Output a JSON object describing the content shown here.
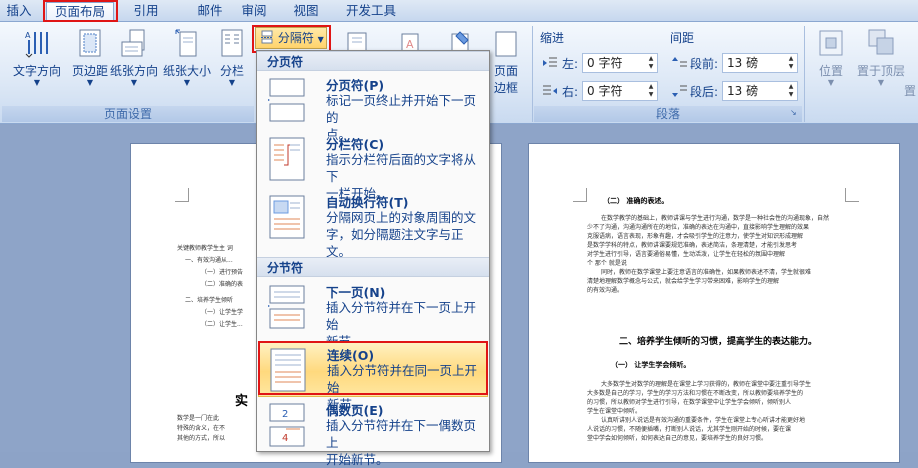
{
  "tabs": {
    "insert": "插入",
    "page_layout": "页面布局",
    "references": "引用",
    "mailings": "邮件",
    "review": "审阅",
    "view": "视图",
    "developer": "开发工具"
  },
  "ribbon": {
    "page_setup": {
      "label": "页面设置",
      "text_direction": "文字方向",
      "margins": "页边距",
      "orientation": "纸张方向",
      "size": "纸张大小",
      "columns": "分栏",
      "breaks": "分隔符"
    },
    "paragraph": {
      "label": "段落",
      "indent_label": "缩进",
      "spacing_label": "间距",
      "left_label": "左:",
      "left_value": "0 字符",
      "right_label": "右:",
      "right_value": "0 字符",
      "before_label": "段前:",
      "before_value": "13 磅",
      "after_label": "段后:",
      "after_value": "13 磅"
    },
    "page_border": "页面\n边框",
    "page_border_l1": "页面",
    "page_border_l2": "边框",
    "arrange": {
      "position": "位置",
      "bring_front": "置于顶层",
      "send_back": "置"
    }
  },
  "menu": {
    "page_breaks_header": "分页符",
    "section_breaks_header": "分节符",
    "items": [
      {
        "title": "分页符(P)",
        "desc_line1": "标记一页终止并开始下一页的",
        "desc_line2": "点。"
      },
      {
        "title": "分栏符(C)",
        "desc_line1": "指示分栏符后面的文字将从下",
        "desc_line2": "一栏开始。"
      },
      {
        "title": "自动换行符(T)",
        "desc_line1": "分隔网页上的对象周围的文",
        "desc_line2": "字，如分隔题注文字与正文。"
      },
      {
        "title": "下一页(N)",
        "desc_line1": "插入分节符并在下一页上开始",
        "desc_line2": "新节。"
      },
      {
        "title": "连续(O)",
        "desc_line1": "插入分节符并在同一页上开始",
        "desc_line2": "新节。"
      },
      {
        "title": "偶数页(E)",
        "desc_line1": "插入分节符并在下一偶数页上",
        "desc_line2": "开始新节。"
      }
    ]
  },
  "document": {
    "left_page_heading": "实",
    "right_page": {
      "line1": "（二）   准确的表述。",
      "heading": "二、培养学生倾听的习惯，提高学生的表达能力。",
      "sub": "（一）   让学生学会倾听。"
    }
  }
}
